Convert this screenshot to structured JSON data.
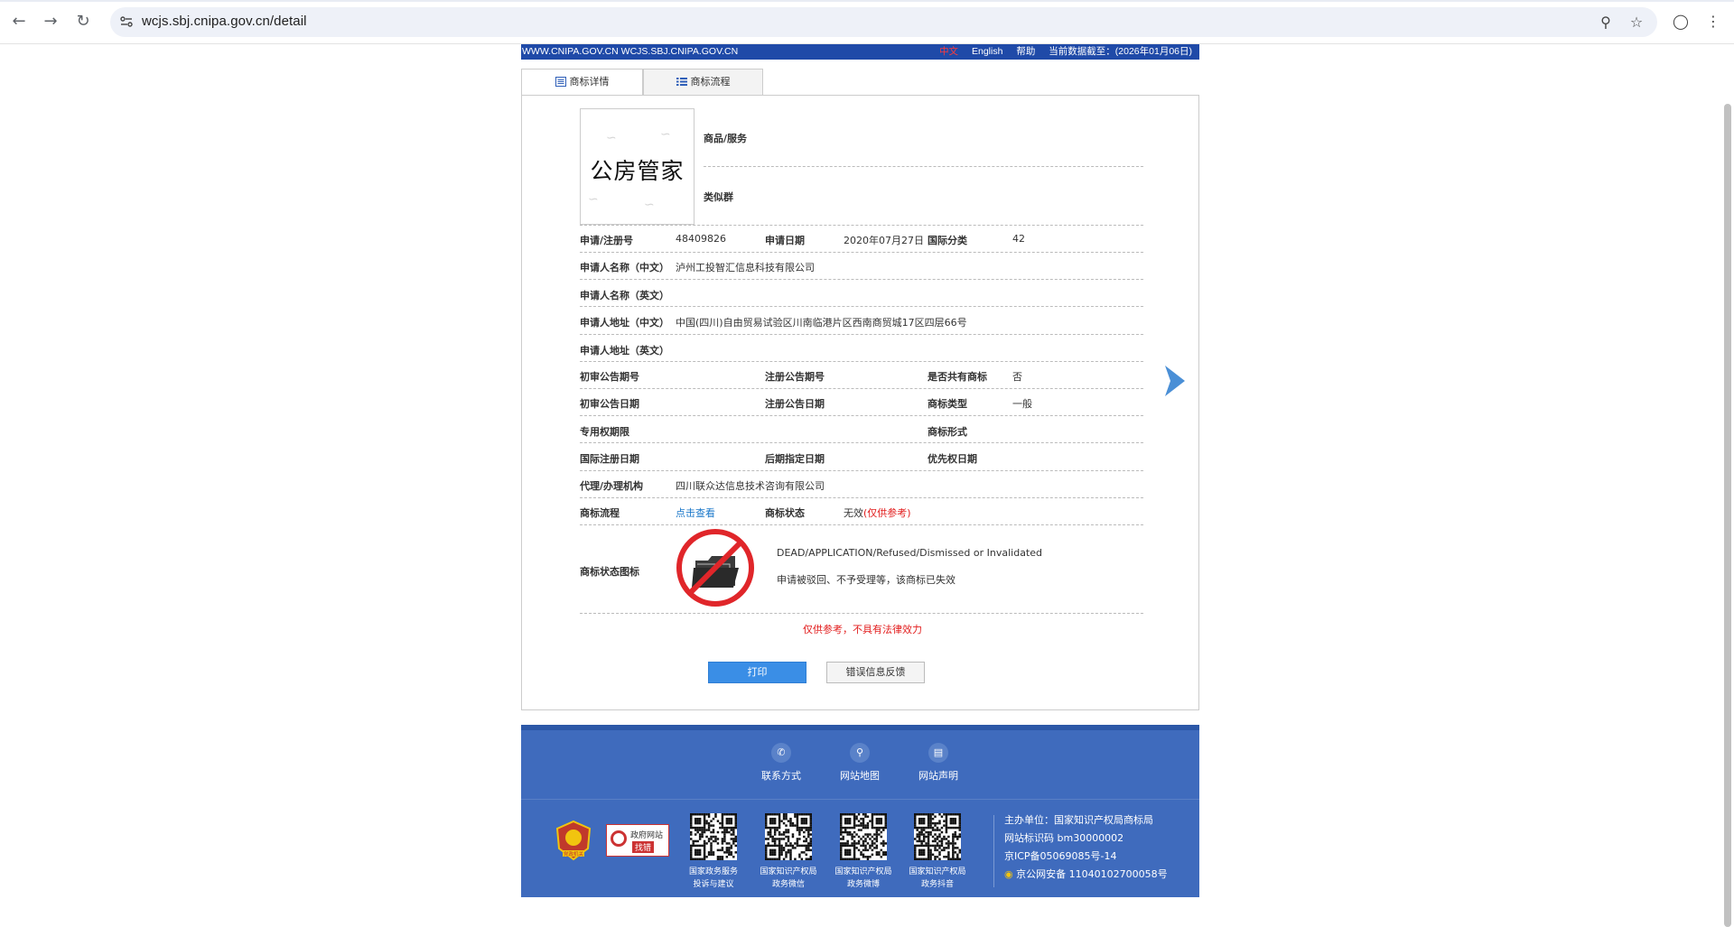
{
  "browser": {
    "url": "wcjs.sbj.cnipa.gov.cn/detail"
  },
  "topbar": {
    "left_text": "WWW.CNIPA.GOV.CN WCJS.SBJ.CNIPA.GOV.CN",
    "lang_cn": "中文",
    "lang_en": "English",
    "help": "帮助",
    "data_date": "当前数据截至：(2026年01月06日)"
  },
  "tabs": [
    {
      "label": "商标详情"
    },
    {
      "label": "商标流程"
    }
  ],
  "trademark": {
    "image_text": "公房管家",
    "goods_label": "商品/服务",
    "similar_group_label": "类似群",
    "reg_no_label": "申请/注册号",
    "reg_no": "48409826",
    "app_date_label": "申请日期",
    "app_date": "2020年07月27日",
    "intl_class_label": "国际分类",
    "intl_class": "42",
    "applicant_cn_label": "申请人名称（中文）",
    "applicant_cn": "泸州工投智汇信息科技有限公司",
    "applicant_en_label": "申请人名称（英文）",
    "address_cn_label": "申请人地址（中文）",
    "address_cn": "中国(四川)自由贸易试验区川南临港片区西南商贸城17区四层66号",
    "address_en_label": "申请人地址（英文）",
    "prelim_pub_no_label": "初审公告期号",
    "reg_pub_no_label": "注册公告期号",
    "shared_label": "是否共有商标",
    "shared": "否",
    "prelim_pub_date_label": "初审公告日期",
    "reg_pub_date_label": "注册公告日期",
    "tm_type_label": "商标类型",
    "tm_type": "一般",
    "exclusive_period_label": "专用权期限",
    "tm_form_label": "商标形式",
    "intl_reg_date_label": "国际注册日期",
    "later_designation_label": "后期指定日期",
    "priority_date_label": "优先权日期",
    "agent_label": "代理/办理机构",
    "agent": "四川联众达信息技术咨询有限公司",
    "flow_label": "商标流程",
    "flow_link": "点击查看",
    "status_label": "商标状态",
    "status_value": "无效",
    "status_note": "(仅供参考)",
    "status_icon_label": "商标状态图标",
    "status_en": "DEAD/APPLICATION/Refused/Dismissed or Invalidated",
    "status_cn": "申请被驳回、不予受理等，该商标已失效",
    "disclaimer": "仅供参考，不具有法律效力"
  },
  "buttons": {
    "print": "打印",
    "feedback": "错误信息反馈"
  },
  "footer": {
    "links": [
      {
        "label": "联系方式",
        "icon": "phone-icon"
      },
      {
        "label": "网站地图",
        "icon": "sitemap-icon"
      },
      {
        "label": "网站声明",
        "icon": "document-icon"
      }
    ],
    "badge_gov": "党政机关",
    "badge_error": [
      "政府网站",
      "找错"
    ],
    "qrs": [
      {
        "caption": [
          "国家政务服务",
          "投诉与建议"
        ]
      },
      {
        "caption": [
          "国家知识产权局",
          "政务微信"
        ]
      },
      {
        "caption": [
          "国家知识产权局",
          "政务微博"
        ]
      },
      {
        "caption": [
          "国家知识产权局",
          "政务抖音"
        ]
      }
    ],
    "sponsor": "主办单位：国家知识产权局商标局",
    "site_id": "网站标识码 bm30000002",
    "icp": "京ICP备05069085号-14",
    "police": "京公网安备 11040102700058号"
  },
  "colors": {
    "topbar": "#1f4aa8",
    "footer": "#3f6bbd",
    "print_button": "#3a8ee6",
    "status_red": "#e21c1c",
    "link_blue": "#1a77c9"
  }
}
